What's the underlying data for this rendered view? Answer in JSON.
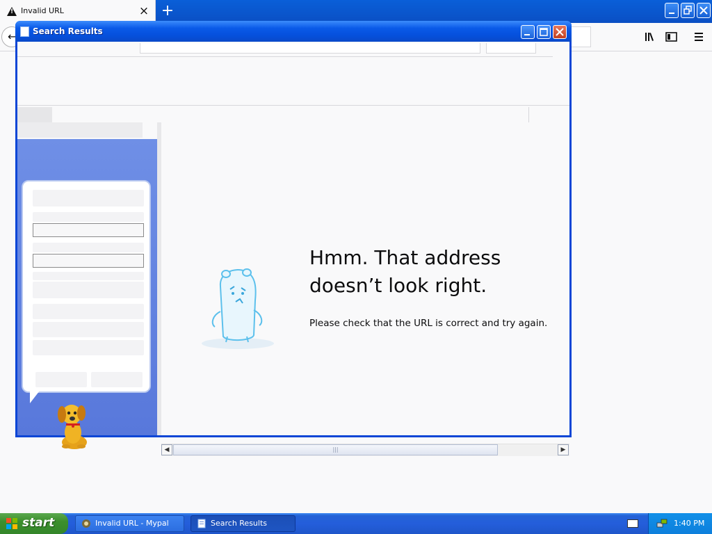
{
  "browser": {
    "tab_title": "Invalid URL",
    "tab_close_glyph": "×",
    "new_tab_glyph": "+",
    "back_glyph": "←",
    "toolbar_icons": [
      "library-icon",
      "sidebar-icon",
      "menu-icon"
    ],
    "window_controls": [
      "minimize",
      "restore",
      "close"
    ]
  },
  "search_window": {
    "title": "Search Results",
    "controls": [
      "minimize",
      "maximize",
      "close"
    ],
    "error": {
      "title": "Hmm. That address doesn’t look right.",
      "description": "Please check that the URL is correct and try again."
    },
    "scrollbar_grip": "|||"
  },
  "taskbar": {
    "start_label": "start",
    "buttons": [
      {
        "label": "Invalid URL - Mypal",
        "active": false
      },
      {
        "label": "Search Results",
        "active": true
      }
    ],
    "clock": "1:40 PM"
  },
  "colors": {
    "xp_blue": "#0a5ae8",
    "taskbar_blue": "#245edb",
    "start_green": "#3c8f2c",
    "close_red": "#c2401f",
    "sidebar_blue": "#6f8fe6"
  }
}
